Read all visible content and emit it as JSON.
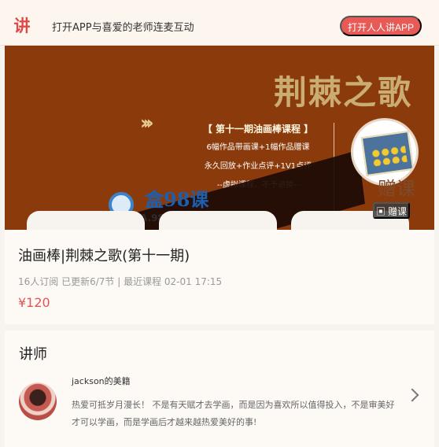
{
  "topbar": {
    "logo": "讲",
    "message": "打开APP与喜爱的老师连麦互动",
    "open_button": "打开人人讲APP"
  },
  "banner": {
    "title": "荆棘之歌",
    "course_heading": "【 第十一期油画棒课程 】",
    "details": [
      "6幅作品带画课+1幅作品赠课",
      "永久回放+作业点评+1V1点评",
      "--虚拟课程，不予退换--"
    ],
    "gift_label": "赠课",
    "gift_button": "赠课",
    "watermark_text": "盒98课",
    "watermark_url": "A.98KE.COM"
  },
  "course": {
    "title": "油画棒|荆棘之歌(第十一期)",
    "meta": "16人订阅   已更新6/7节 | 最近课程 02-01 17:15",
    "price": "¥120"
  },
  "teacher": {
    "section_title": "讲师",
    "name": "jackson的美籍",
    "bio": "热爱可抵岁月漫长！ 不是有天赋才去学画，而是因为喜欢所以值得投入，不是审美好才可以学画，而是学画后才越来越热爱美好的事!"
  },
  "colors": {
    "accent": "#e85a55",
    "banner": "#8b3b0b",
    "background": "#f7f3ee"
  }
}
